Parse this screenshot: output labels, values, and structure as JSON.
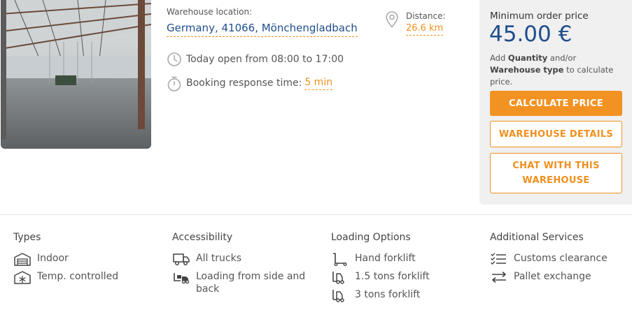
{
  "location": {
    "label": "Warehouse location:",
    "value": "Germany, 41066, Mönchengladbach"
  },
  "opening": {
    "text": "Today open from 08:00 to 17:00",
    "icon": "clock-icon"
  },
  "booking": {
    "label": "Booking response time:",
    "value": "5 min",
    "icon": "stopwatch-icon"
  },
  "distance": {
    "label": "Distance:",
    "value": "26.6 km",
    "icon": "map-pin-icon"
  },
  "price": {
    "label": "Minimum order price",
    "value": "45.00 €",
    "note_prefix": "Add ",
    "note_quantity": "Quantity",
    "note_mid": " and/or ",
    "note_type": "Warehouse type",
    "note_suffix": " to calculate price.",
    "calculate_button": "CALCULATE PRICE",
    "details_button": "WAREHOUSE DETAILS",
    "chat_button": "CHAT WITH THIS WAREHOUSE"
  },
  "features": {
    "types": {
      "title": "Types",
      "items": [
        {
          "label": "Indoor",
          "icon": "warehouse-icon"
        },
        {
          "label": "Temp. controlled",
          "icon": "snowflake-icon"
        }
      ]
    },
    "accessibility": {
      "title": "Accessibility",
      "items": [
        {
          "label": "All trucks",
          "icon": "truck-icon"
        },
        {
          "label": "Loading from side and back",
          "icon": "loading-icon"
        }
      ]
    },
    "loading": {
      "title": "Loading Options",
      "items": [
        {
          "label": "Hand forklift",
          "icon": "hand-forklift-icon"
        },
        {
          "label": "1.5 tons forklift",
          "icon": "forklift-icon"
        },
        {
          "label": "3 tons forklift",
          "icon": "forklift-icon"
        }
      ]
    },
    "services": {
      "title": "Additional Services",
      "items": [
        {
          "label": "Customs clearance",
          "icon": "checklist-icon"
        },
        {
          "label": "Pallet exchange",
          "icon": "exchange-arrows-icon"
        }
      ]
    }
  },
  "colors": {
    "accent": "#f29222",
    "brand": "#1f4e8c",
    "panel": "#f0f0f0"
  }
}
